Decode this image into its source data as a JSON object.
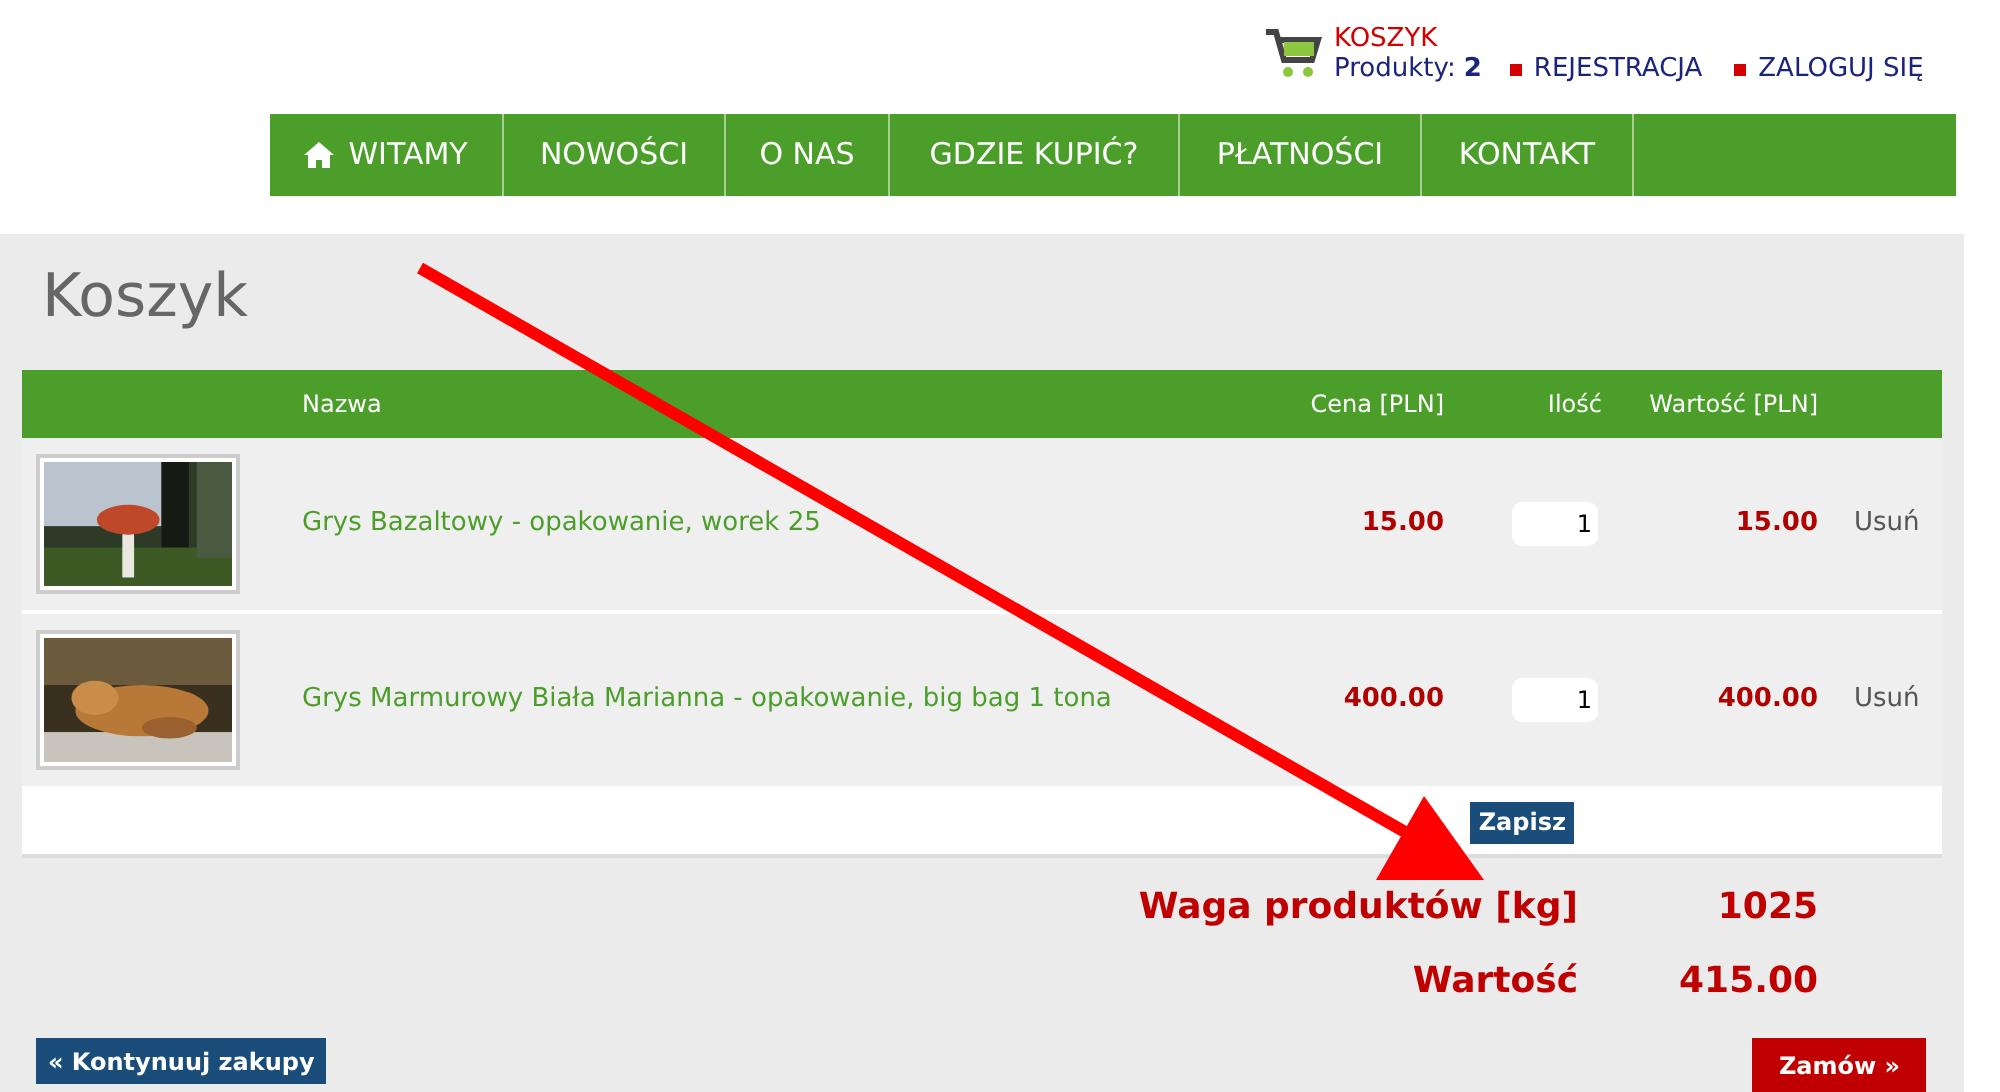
{
  "header": {
    "cart": {
      "title": "KOSZYK",
      "label": "Produkty:",
      "count": "2"
    },
    "links": [
      "REJESTRACJA",
      "ZALOGUJ SIĘ"
    ]
  },
  "nav": [
    {
      "label": "WITAMY"
    },
    {
      "label": "NOWOŚCI"
    },
    {
      "label": "O NAS"
    },
    {
      "label": "GDZIE KUPIĆ?"
    },
    {
      "label": "PŁATNOŚCI"
    },
    {
      "label": "KONTAKT"
    }
  ],
  "page_title": "Koszyk",
  "cart_table": {
    "columns": [
      "Nazwa",
      "Cena [PLN]",
      "Ilość",
      "Wartość [PLN]"
    ],
    "rows": [
      {
        "name": "Grys Bazaltowy - opakowanie, worek 25",
        "price": "15.00",
        "quantity": "1",
        "total": "15.00",
        "remove": "Usuń"
      },
      {
        "name": "Grys Marmurowy Biała Marianna - opakowanie, big bag 1 tona",
        "price": "400.00",
        "quantity": "1",
        "total": "400.00",
        "remove": "Usuń"
      }
    ]
  },
  "save_button": "Zapisz",
  "summary": [
    {
      "label": "Waga produktów [kg]",
      "value": "1025"
    },
    {
      "label": "Wartość",
      "value": "415.00"
    }
  ],
  "buttons": {
    "continue": "« Kontynuuj zakupy",
    "order": "Zamów »"
  }
}
